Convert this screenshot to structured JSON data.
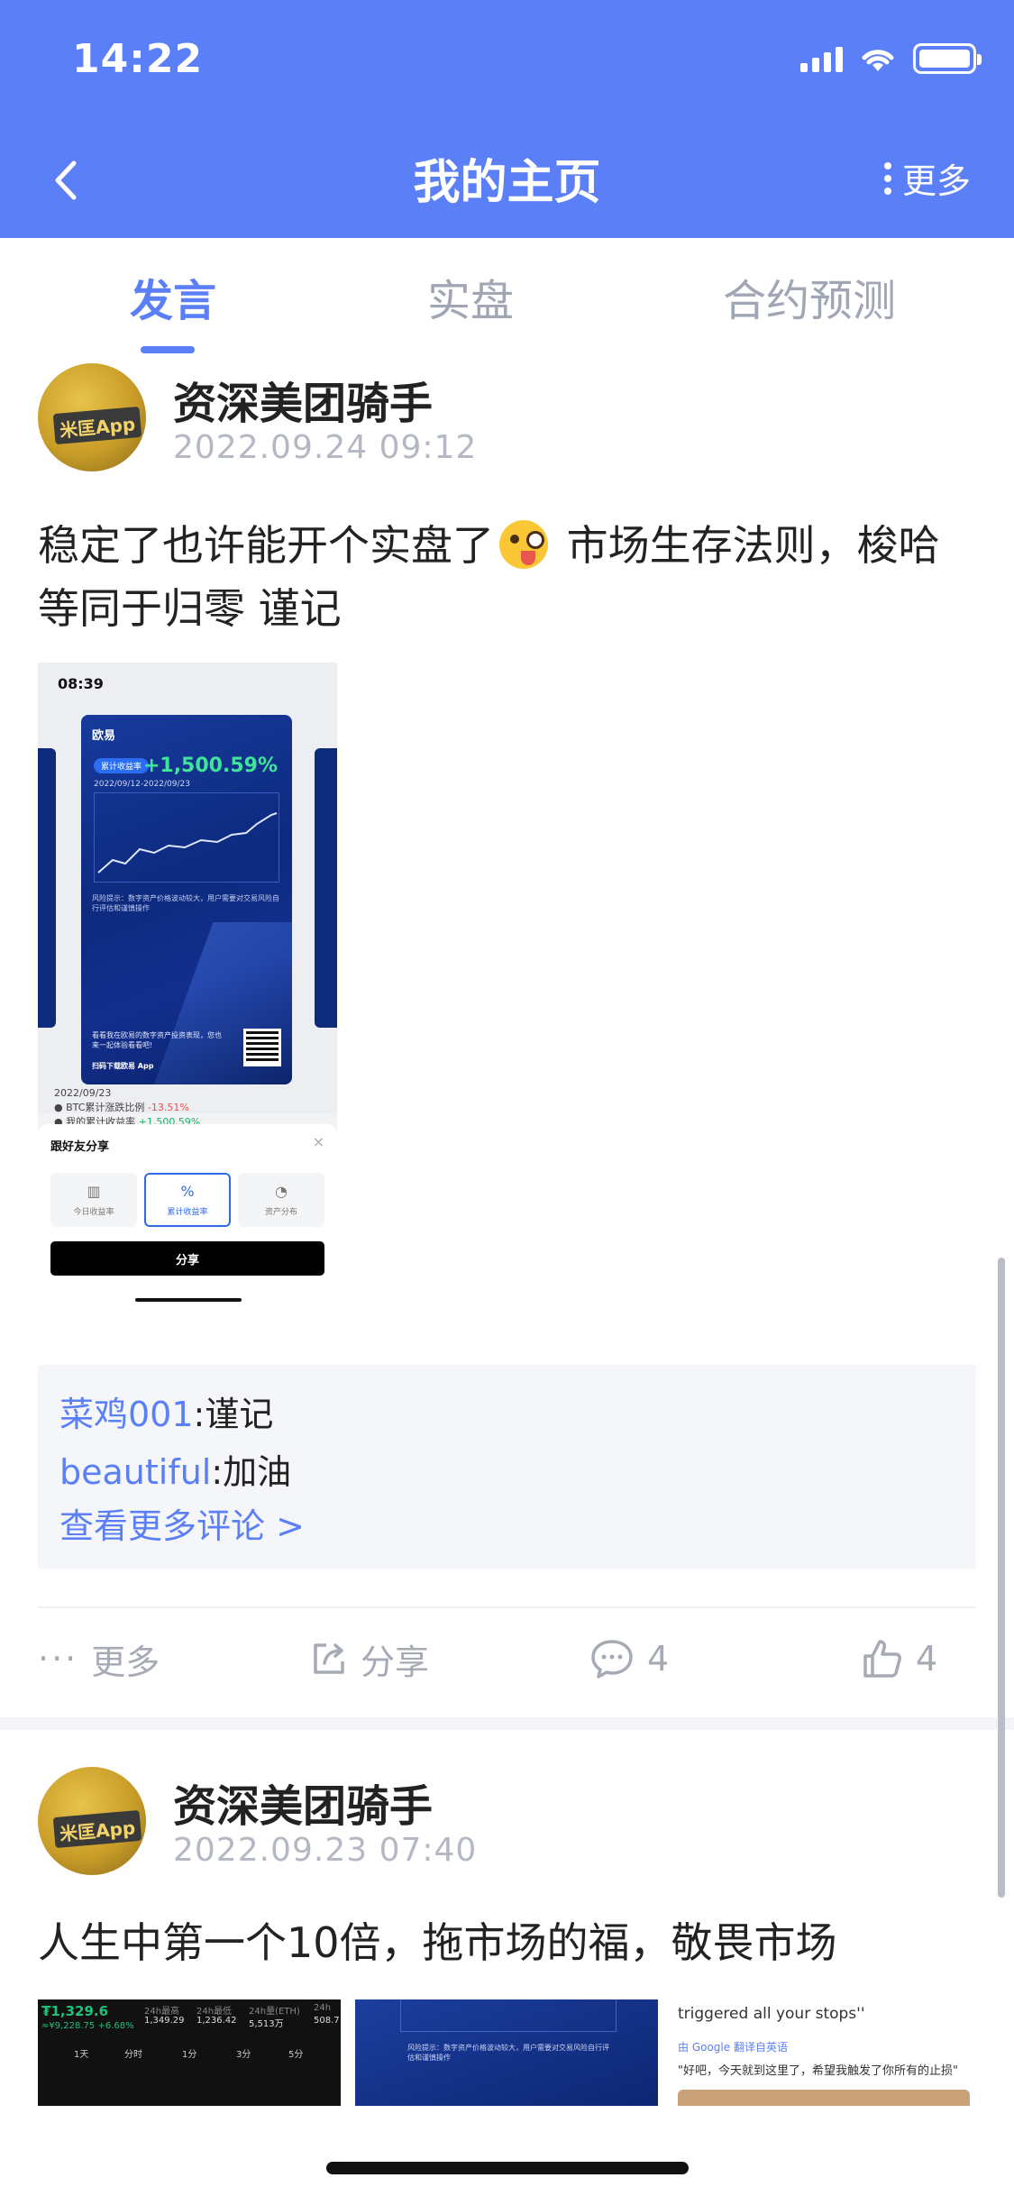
{
  "status_bar": {
    "time": "14:22"
  },
  "nav": {
    "title": "我的主页",
    "more_label": "更多"
  },
  "tabs": [
    {
      "label": "发言",
      "active": true
    },
    {
      "label": "实盘",
      "active": false
    },
    {
      "label": "合约预测",
      "active": false
    }
  ],
  "posts": [
    {
      "author": "资深美团骑手",
      "avatar_text": "米匡App",
      "time": "2022.09.24 09:12",
      "text_before_emoji": "稳定了也许能开个实盘了",
      "text_after_emoji": " 市场生存法则，梭哈等同于归零 谨记",
      "emoji": "zany-face",
      "image": {
        "status_time": "08:39",
        "brand": "欧易",
        "pill": "累计收益率",
        "pct": "+1,500.59%",
        "range": "2022/09/12-2022/09/23",
        "risk": "风险提示：数字资产价格波动较大，用户需要对交易风险自行评估和谨慎操作",
        "foot": "看看我在欧易的数字资产投资表现，您也来一起体验看看吧!",
        "download": "扫码下载欧易 App",
        "line1_label": "BTC累计涨跌比例",
        "line1_value": "-13.51%",
        "line2_label": "我的累计收益率",
        "line2_value": "+1,500.59%",
        "date": "2022/09/23",
        "sheet_title": "跟好友分享",
        "options": [
          "今日收益率",
          "累计收益率",
          "资产分布"
        ],
        "share_button": "分享"
      },
      "comments": [
        {
          "user": "菜鸡001",
          "text": ":谨记"
        },
        {
          "user": "beautiful",
          "text": ":加油"
        }
      ],
      "more_comments": "查看更多评论 >",
      "actions": {
        "more": "更多",
        "share": "分享",
        "comments": "4",
        "likes": "4"
      }
    },
    {
      "author": "资深美团骑手",
      "avatar_text": "米匡App",
      "time": "2022.09.23 07:40",
      "text": "人生中第一个10倍，拖市场的福，敬畏市场",
      "thumb1": {
        "price": "₮1,329.6",
        "sub": "≈¥9,228.75 +6.68%",
        "h1": "24h最高",
        "v1": "1,349.29",
        "h2": "24h最低",
        "v2": "1,236.42",
        "h3": "24h量(ETH)",
        "v3": "5,513万",
        "h4": "24h",
        "v4": "508.7",
        "t1": "1天",
        "t2": "分时",
        "t3": "1分",
        "t4": "3分",
        "t5": "5分"
      },
      "thumb2": {
        "risk": "风险提示：数字资产价格波动较大，用户需要对交易风险自行评估和谨慎操作"
      },
      "thumb3": {
        "line1": "triggered all your stops''",
        "google": "由 Google 翻译自英语",
        "line2": "\"好吧，今天就到这里了，希望我触发了你所有的止损\""
      }
    }
  ],
  "colors": {
    "accent": "#5b7ff7",
    "header_bg": "#5b7ff7",
    "muted": "#a5aab4"
  }
}
